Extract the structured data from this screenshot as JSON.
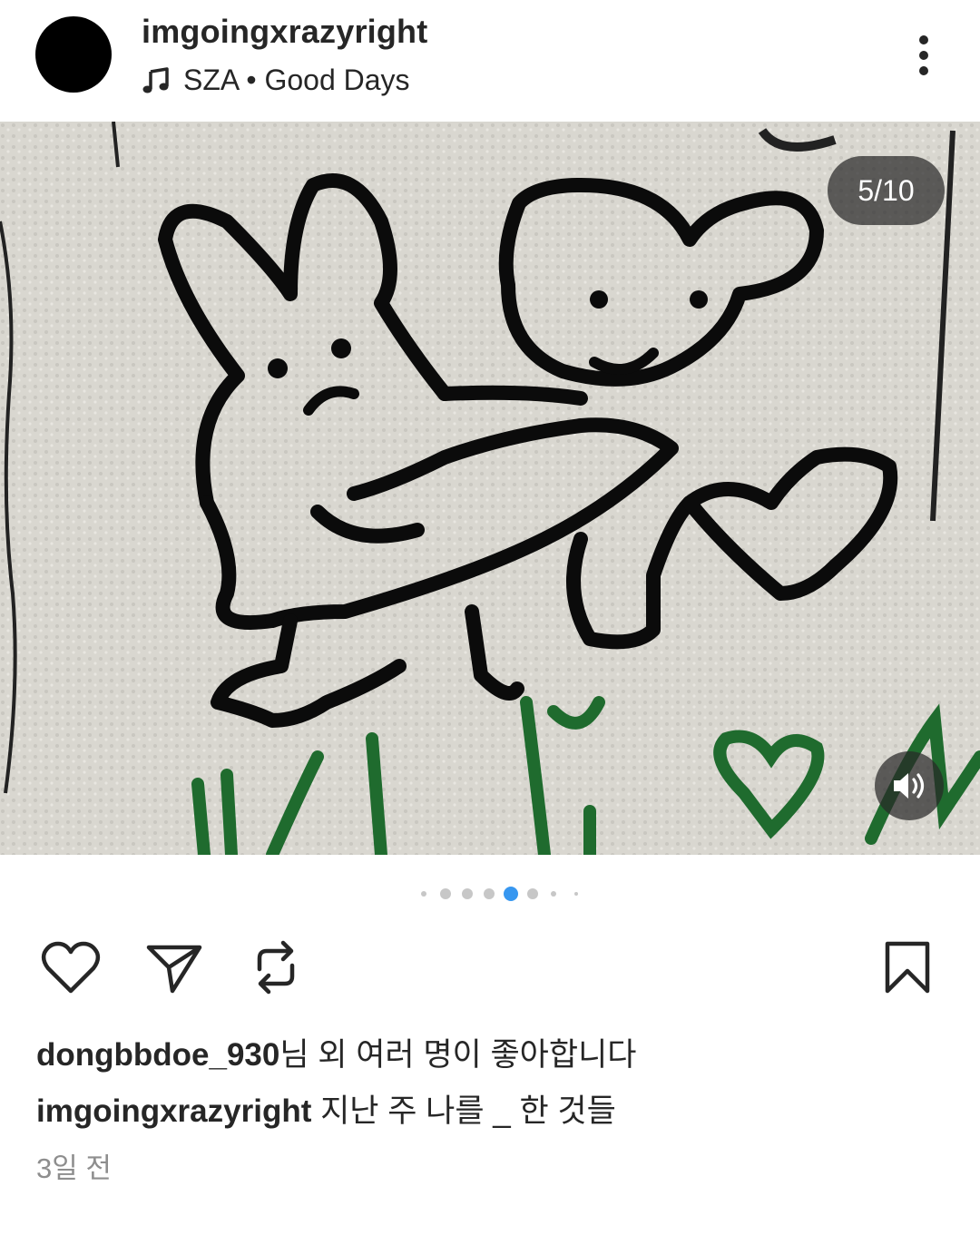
{
  "post": {
    "username": "imgoingxrazyright",
    "music": {
      "icon": "music-note-icon",
      "text": "SZA • Good Days"
    },
    "more_icon": "more-vertical-icon"
  },
  "media": {
    "counter": "5/10",
    "current_index": 5,
    "total": 10,
    "sound_icon": "volume-icon"
  },
  "actions": {
    "like_icon": "heart-icon",
    "share_icon": "send-icon",
    "repost_icon": "repost-icon",
    "save_icon": "bookmark-icon"
  },
  "likes": {
    "user": "dongbbdoe_930",
    "suffix": "님 외 여러 명이 좋아합니다"
  },
  "caption": {
    "user": "imgoingxrazyright",
    "text": " 지난 주 나를 _ 한 것들"
  },
  "timestamp": "3일 전",
  "colors": {
    "active_dot": "#3797f0",
    "inactive_dot": "#c7c7c7",
    "text": "#262626",
    "muted": "#8e8e8e"
  }
}
